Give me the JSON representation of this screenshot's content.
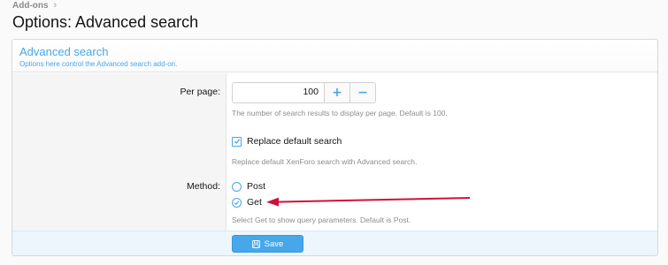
{
  "breadcrumb": {
    "items": [
      "Add-ons"
    ]
  },
  "page": {
    "title": "Options: Advanced search"
  },
  "panel": {
    "title": "Advanced search",
    "description": "Options here control the Advanced search add-on."
  },
  "per_page": {
    "label": "Per page:",
    "value": "100",
    "increment_label": "+",
    "decrement_label": "−",
    "hint": "The number of search results to display per page. Default is 100."
  },
  "replace_search": {
    "label": "Replace default search",
    "checked": true,
    "hint": "Replace default XenForo search with Advanced search."
  },
  "method": {
    "label": "Method:",
    "options": [
      {
        "label": "Post",
        "selected": false
      },
      {
        "label": "Get",
        "selected": true
      }
    ],
    "hint": "Select Get to show query parameters. Default is Post."
  },
  "footer": {
    "save_label": "Save"
  },
  "colors": {
    "accent": "#47a7eb",
    "annotation_arrow": "#d0103a"
  },
  "icons": {
    "breadcrumb_sep": "chevron-right-icon",
    "checkbox": "checkmark-icon",
    "save": "floppy-disk-icon"
  }
}
